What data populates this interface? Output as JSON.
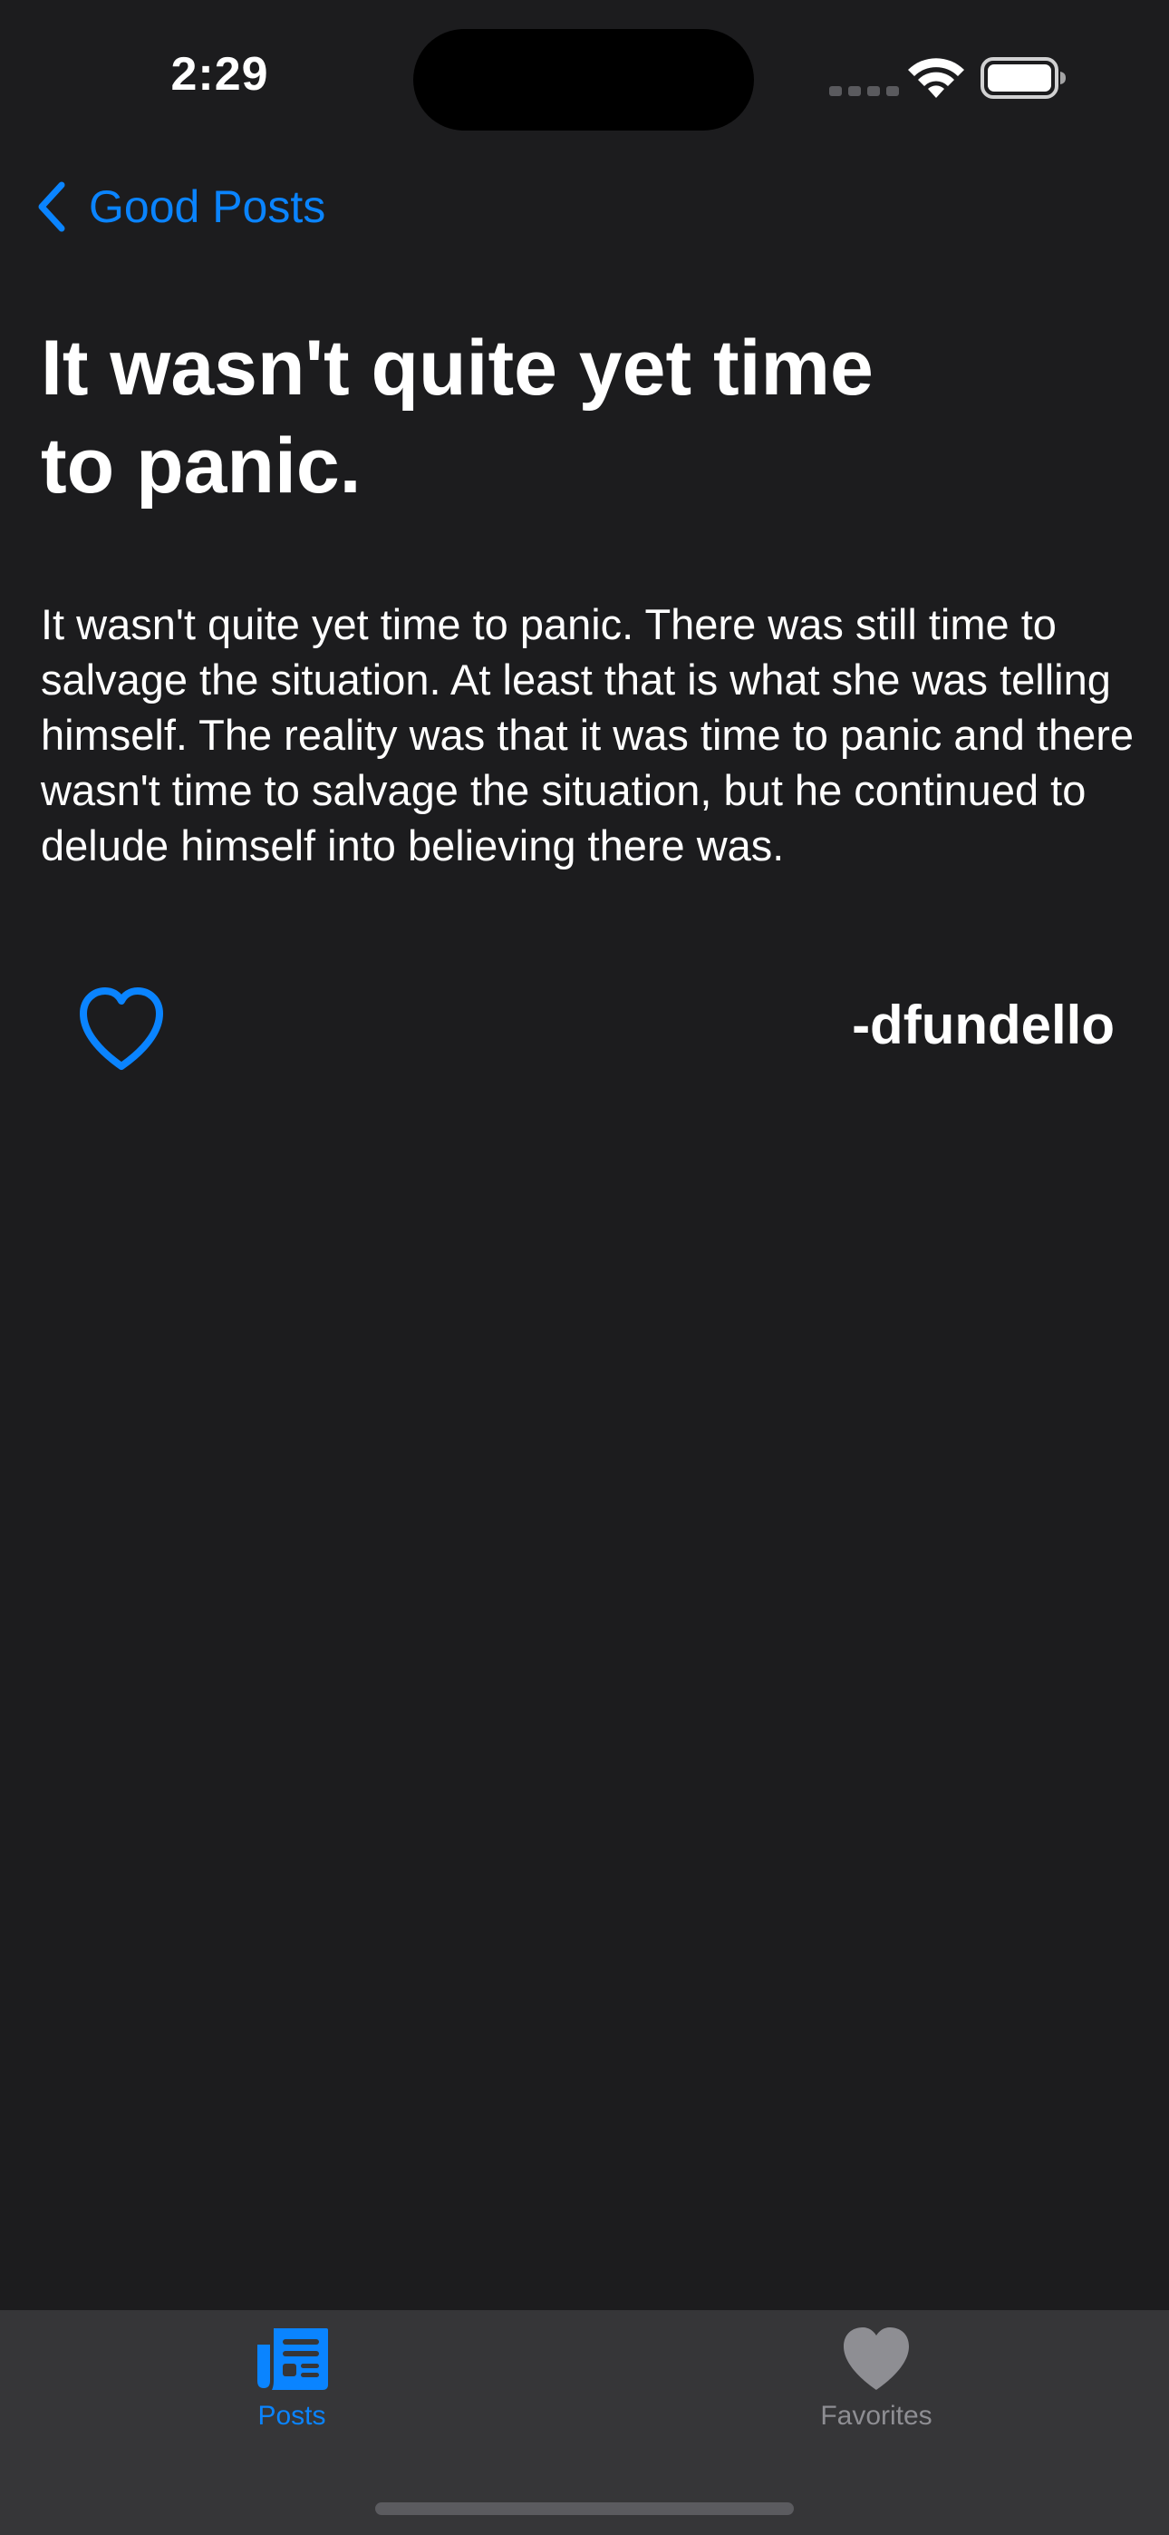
{
  "status_bar": {
    "time": "2:29"
  },
  "navigation": {
    "back_label": "Good Posts",
    "back_icon": "chevron-left-icon"
  },
  "post": {
    "title": "It wasn't quite yet time to panic.",
    "body": "It wasn't quite yet time to panic. There was still time to salvage the situation. At least that is what she was telling himself. The reality was that it was time to panic and there wasn't time to salvage the situation, but he continued to delude himself into believing there was.",
    "author": "-dfundello",
    "favorite_icon": "heart-outline-icon",
    "is_favorited": false
  },
  "tab_bar": {
    "selected": "Posts",
    "tabs": [
      {
        "label": "Posts",
        "icon": "newspaper-icon",
        "active": true
      },
      {
        "label": "Favorites",
        "icon": "heart-fill-icon",
        "active": false
      }
    ]
  },
  "colors": {
    "background": "#1c1c1e",
    "accent": "#0a84ff",
    "tab_bar_background": "#363638",
    "inactive": "#8e8e93",
    "text": "#ffffff"
  }
}
